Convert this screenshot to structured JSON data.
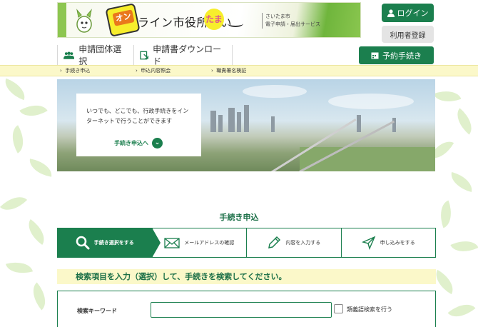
{
  "header": {
    "on_badge": "オン",
    "logo_text": "ライン市役所さい",
    "logo_tama": "たま",
    "subtext_line1": "さいたま市",
    "subtext_line2": "電子申請・届出サービス",
    "login_label": "ログイン",
    "register_label": "利用者登録"
  },
  "nav": {
    "items": [
      {
        "label": "申請団体選択",
        "icon": "group-icon"
      },
      {
        "label": "申請書ダウンロード",
        "icon": "download-document-icon"
      }
    ],
    "reserve_label": "予約手続き"
  },
  "subnav": {
    "items": [
      {
        "label": "手続き申込"
      },
      {
        "label": "申込内容照会"
      },
      {
        "label": "職責署名検証"
      }
    ]
  },
  "hero": {
    "text": "いつでも、どこでも、行政手続きをインターネットで行うことができます",
    "link_label": "手続き申込へ"
  },
  "section": {
    "title": "手続き申込"
  },
  "steps": [
    {
      "label": "手続き選択をする",
      "icon": "search-icon",
      "active": true
    },
    {
      "label": "メールアドレスの確認",
      "icon": "mail-icon",
      "active": false
    },
    {
      "label": "内容を入力する",
      "icon": "pencil-icon",
      "active": false
    },
    {
      "label": "申し込みをする",
      "icon": "send-icon",
      "active": false
    }
  ],
  "search": {
    "instruction": "検索項目を入力（選択）して、手続きを検索してください。",
    "keyword_label": "検索キーワード",
    "keyword_value": "",
    "similar_label": "類義語検索を行う"
  },
  "colors": {
    "primary": "#1b7f4e",
    "band": "#fbf8c9",
    "accent_yellow": "#f7ee2c",
    "accent_orange": "#e9781c"
  }
}
